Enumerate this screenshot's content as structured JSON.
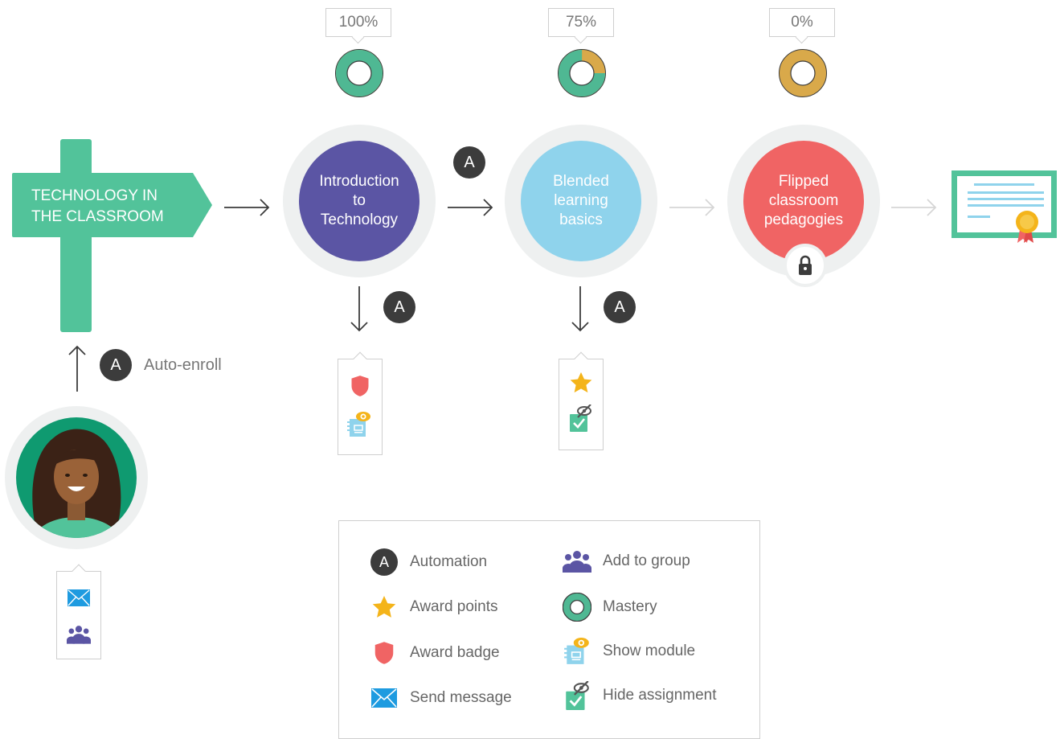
{
  "signpost": {
    "line1": "TECHNOLOGY IN",
    "line2": "THE CLASSROOM"
  },
  "auto_enroll": {
    "badge": "A",
    "label": "Auto-enroll"
  },
  "courses": [
    {
      "line1": "Introduction",
      "line2": "to",
      "line3": "Technology",
      "mastery_label": "100%",
      "mastery": 1.0,
      "color": "#5b55a4",
      "state": "open"
    },
    {
      "line1": "Blended",
      "line2": "learning",
      "line3": "basics",
      "mastery_label": "75%",
      "mastery": 0.75,
      "color": "#8fd3ec",
      "state": "open"
    },
    {
      "line1": "Flipped",
      "line2": "classroom",
      "line3": "pedagogies",
      "mastery_label": "0%",
      "mastery": 0.0,
      "color": "#f06464",
      "state": "locked"
    }
  ],
  "automation_badge": "A",
  "legend": {
    "items": [
      {
        "icon": "automation-icon",
        "label": "Automation",
        "badge": "A"
      },
      {
        "icon": "add-to-group-icon",
        "label": "Add to group"
      },
      {
        "icon": "star-icon",
        "label": "Award points"
      },
      {
        "icon": "mastery-icon",
        "label": "Mastery"
      },
      {
        "icon": "badge-shield-icon",
        "label": "Award badge"
      },
      {
        "icon": "show-module-icon",
        "label": "Show module"
      },
      {
        "icon": "envelope-icon",
        "label": "Send message"
      },
      {
        "icon": "hide-assignment-icon",
        "label": "Hide assignment"
      }
    ]
  },
  "colors": {
    "teal": "#52c39a",
    "mastery_green": "#4fb893",
    "mastery_gold": "#d9a94a",
    "dark_arrow": "#3c3c3c",
    "light_arrow": "#d6d6d6",
    "badge_red": "#f06464",
    "star": "#f4b41a",
    "envelope": "#1e9be0",
    "group": "#5b55a4"
  }
}
